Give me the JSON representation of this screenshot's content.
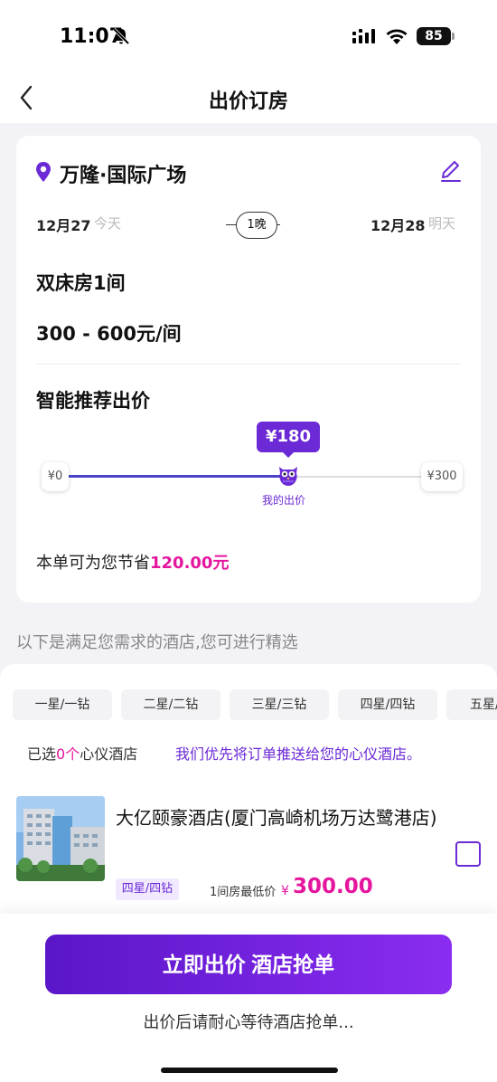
{
  "status_bar": {
    "time": "11:07",
    "battery": "85"
  },
  "nav": {
    "title": "出价订房"
  },
  "order": {
    "location": "万隆·国际广场",
    "checkin_date": "12月27",
    "checkin_label": "今天",
    "nights": "1晚",
    "checkout_date": "12月28",
    "checkout_label": "明天",
    "room": "双床房1间",
    "price_range": "300 - 600元/间"
  },
  "recommend": {
    "title": "智能推荐出价",
    "min": "¥0",
    "max": "¥300",
    "bid": "¥180",
    "bid_fraction": 0.6,
    "bid_label": "我的出价",
    "save_prefix": "本单可为您节省",
    "save_amount": "120.00元"
  },
  "hint": "以下是满足您需求的酒店,您可进行精选",
  "filters": [
    "一星/一钻",
    "二星/二钻",
    "三星/三钻",
    "四星/四钻",
    "五星/五钻"
  ],
  "selection": {
    "prefix": "已选",
    "count": "0个",
    "suffix": "心仪酒店",
    "push_note": "我们优先将订单推送给您的心仪酒店。"
  },
  "hotel": {
    "name": "大亿颐豪酒店(厦门高崎机场万达鹭港店)",
    "star": "四星/四钻",
    "lowest_label": "1间房最低价",
    "currency": "¥",
    "price": "300.00",
    "selected": false
  },
  "cta": {
    "label": "立即出价 酒店抢单",
    "note": "出价后请耐心等待酒店抢单..."
  },
  "colors": {
    "accent": "#6b2ad6",
    "highlight": "#e5169e",
    "slider": "#4b43c7"
  }
}
